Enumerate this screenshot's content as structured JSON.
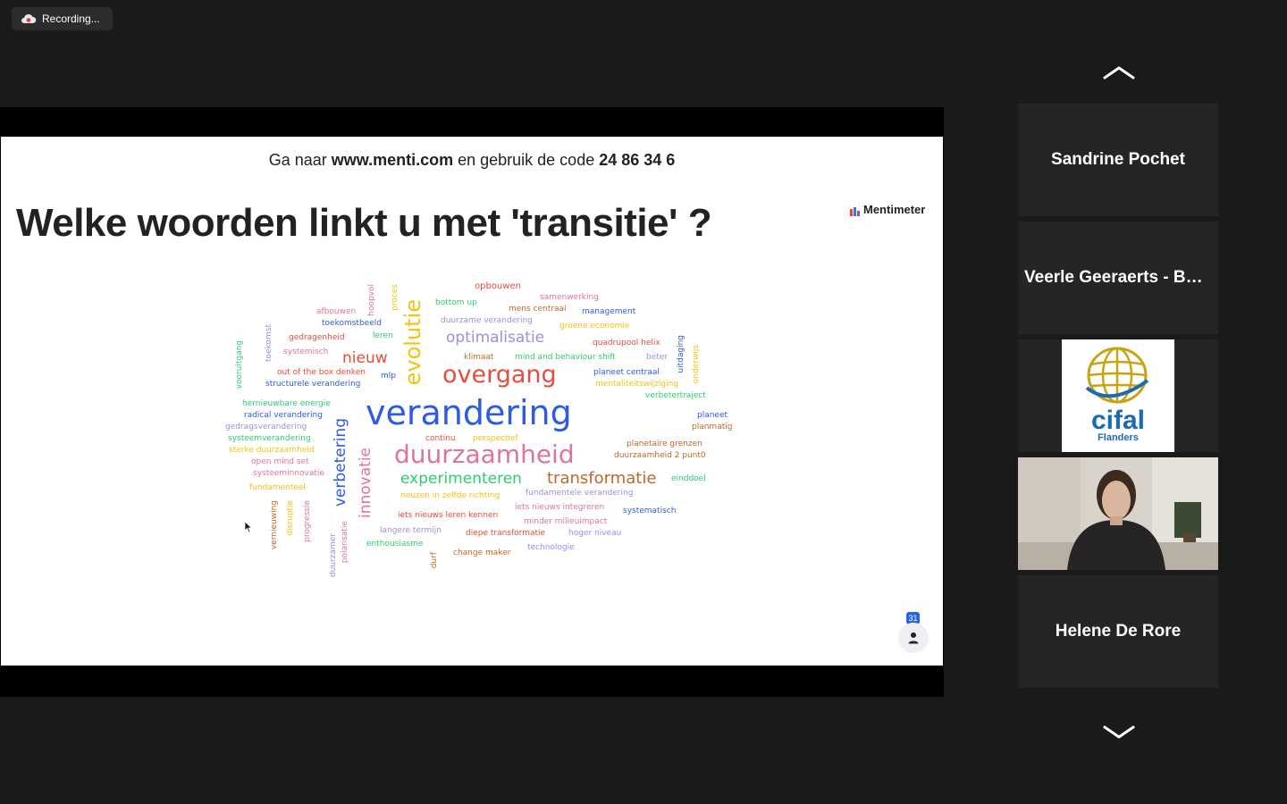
{
  "recording": {
    "label": "Recording..."
  },
  "slide": {
    "instruction_prefix": "Ga naar ",
    "instruction_url": "www.menti.com",
    "instruction_mid": " en gebruik de code ",
    "instruction_code": "24 86 34 6",
    "title": "Welke woorden linkt u met 'transitie' ?",
    "brand": "Mentimeter",
    "participants_count": "31"
  },
  "wordcloud": [
    {
      "text": "opbouwen",
      "color": "#e74c3c"
    },
    {
      "text": "hoopvol",
      "color": "#e0739c"
    },
    {
      "text": "proces",
      "color": "#f1c40f"
    },
    {
      "text": "samenwerking",
      "color": "#e0739c"
    },
    {
      "text": "bottom up",
      "color": "#2ecc71"
    },
    {
      "text": "mens centraal",
      "color": "#c0672a"
    },
    {
      "text": "management",
      "color": "#2d5be3"
    },
    {
      "text": "afbouwen",
      "color": "#e0739c"
    },
    {
      "text": "toekomstbeeld",
      "color": "#2d5be3"
    },
    {
      "text": "duurzame verandering",
      "color": "#9b8fe0"
    },
    {
      "text": "groene economie",
      "color": "#f1c40f"
    },
    {
      "text": "toekomst",
      "color": "#9b8fe0"
    },
    {
      "text": "gedragenheid",
      "color": "#e74c3c"
    },
    {
      "text": "leren",
      "color": "#2ecc71"
    },
    {
      "text": "evolutie",
      "color": "#f1c40f"
    },
    {
      "text": "optimalisatie",
      "color": "#9b8fe0"
    },
    {
      "text": "quadrupool helix",
      "color": "#e74c3c"
    },
    {
      "text": "uitdaging",
      "color": "#2d5be3"
    },
    {
      "text": "onderwijs",
      "color": "#f1c40f"
    },
    {
      "text": "vooruitgang",
      "color": "#2ecc71"
    },
    {
      "text": "systemisch",
      "color": "#e0739c"
    },
    {
      "text": "nieuw",
      "color": "#e74c3c"
    },
    {
      "text": "klimaat",
      "color": "#c0672a"
    },
    {
      "text": "mind and behaviour shift",
      "color": "#2ecc71"
    },
    {
      "text": "beter",
      "color": "#9b8fe0"
    },
    {
      "text": "out of the box denken",
      "color": "#e74c3c"
    },
    {
      "text": "mlp",
      "color": "#2d5be3"
    },
    {
      "text": "overgang",
      "color": "#e74c3c"
    },
    {
      "text": "planeet centraal",
      "color": "#2d5be3"
    },
    {
      "text": "structurele verandering",
      "color": "#2d5be3"
    },
    {
      "text": "mentaliteitswijziging",
      "color": "#f1c40f"
    },
    {
      "text": "verbetertraject",
      "color": "#2ecc71"
    },
    {
      "text": "hernieuwbare energie",
      "color": "#2ecc71"
    },
    {
      "text": "radical verandering",
      "color": "#2d5be3"
    },
    {
      "text": "verandering",
      "color": "#2d5be3"
    },
    {
      "text": "planeet",
      "color": "#2d5be3"
    },
    {
      "text": "planmatig",
      "color": "#c0672a"
    },
    {
      "text": "gedragsverandering",
      "color": "#9b8fe0"
    },
    {
      "text": "verbetering",
      "color": "#2d5be3"
    },
    {
      "text": "systeemverandering",
      "color": "#2ecc71"
    },
    {
      "text": "continu",
      "color": "#e74c3c"
    },
    {
      "text": "perspectief",
      "color": "#f1c40f"
    },
    {
      "text": "planetaire grenzen",
      "color": "#c0672a"
    },
    {
      "text": "sterke duurzaamheid",
      "color": "#f1c40f"
    },
    {
      "text": "duurzaamheid",
      "color": "#e0739c"
    },
    {
      "text": "duurzaamheid 2 punt0",
      "color": "#c0672a"
    },
    {
      "text": "open mind set",
      "color": "#e0739c"
    },
    {
      "text": "innovatie",
      "color": "#e0739c"
    },
    {
      "text": "systeeminnovatie",
      "color": "#e0739c"
    },
    {
      "text": "experimenteren",
      "color": "#2ecc71"
    },
    {
      "text": "transformatie",
      "color": "#c0672a"
    },
    {
      "text": "einddoel",
      "color": "#2ecc71"
    },
    {
      "text": "fundamenteel",
      "color": "#f1c40f"
    },
    {
      "text": "fundamentele verandering",
      "color": "#9b8fe0"
    },
    {
      "text": "neuzen in zelfde richting",
      "color": "#f1c40f"
    },
    {
      "text": "vernieuwing",
      "color": "#c0672a"
    },
    {
      "text": "disruptie",
      "color": "#f1c40f"
    },
    {
      "text": "progressie",
      "color": "#e0739c"
    },
    {
      "text": "iets nieuws integreren",
      "color": "#e0739c"
    },
    {
      "text": "systematisch",
      "color": "#2d5be3"
    },
    {
      "text": "iets nieuws leren kennen",
      "color": "#e74c3c"
    },
    {
      "text": "minder milieuimpact",
      "color": "#e0739c"
    },
    {
      "text": "langere termijn",
      "color": "#9b8fe0"
    },
    {
      "text": "diepe transformatie",
      "color": "#e74c3c"
    },
    {
      "text": "hoger niveau",
      "color": "#9b8fe0"
    },
    {
      "text": "duurzamer",
      "color": "#9b8fe0"
    },
    {
      "text": "polarisatie",
      "color": "#e0739c"
    },
    {
      "text": "enthousiasme",
      "color": "#2ecc71"
    },
    {
      "text": "technologie",
      "color": "#9b8fe0"
    },
    {
      "text": "durf",
      "color": "#c0672a"
    },
    {
      "text": "change maker",
      "color": "#c0672a"
    }
  ],
  "participants": [
    {
      "name": "Sandrine Pochet"
    },
    {
      "name": "Veerle Geeraerts - Bel..."
    },
    {
      "name": "",
      "logo_top": "cifal",
      "logo_bottom": "Flanders"
    },
    {
      "name": ""
    },
    {
      "name": "Helene De Rore"
    }
  ],
  "icons": {
    "recording": "cloud-record-icon",
    "scroll_up": "chevron-up-icon",
    "scroll_down": "chevron-down-icon",
    "participants": "person-icon"
  }
}
